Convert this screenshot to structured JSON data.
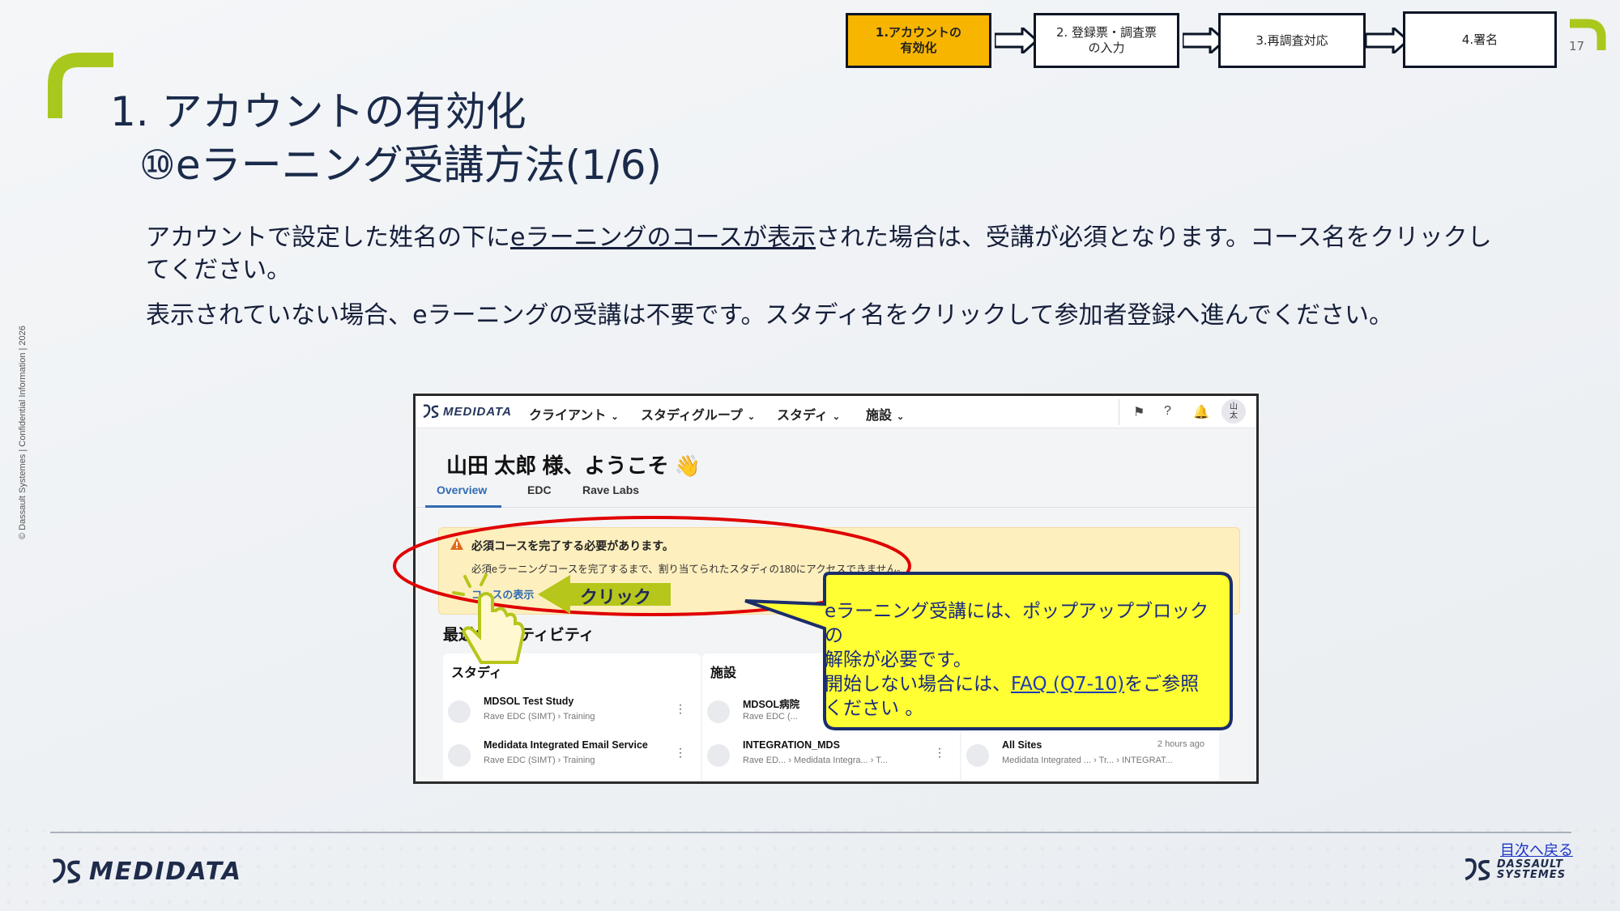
{
  "page": {
    "number": "17",
    "side_note": "© Dassault Systemes | Confidential Information | 2026"
  },
  "steps": [
    {
      "label": "1.アカウントの\n有効化",
      "active": true
    },
    {
      "label": "2. 登録票・調査票\nの入力",
      "active": false
    },
    {
      "label": "3.再調査対応",
      "active": false
    },
    {
      "label": "4.署名",
      "active": false
    }
  ],
  "title": {
    "line1": "1. アカウントの有効化",
    "line2": "⑩eラーニング受講方法(1/6)"
  },
  "body": {
    "para1_a": "アカウントで設定した姓名の下に",
    "para1_link": "eラーニングのコースが表示",
    "para1_b": "された場合は、受講が必須となります。コース名をクリックし",
    "para1_c": "てください。",
    "para2": "表示されていない場合、eラーニングの受講は不要です。スタディ名をクリックして参加者登録へ進んでください。"
  },
  "app": {
    "logo": "MEDIDATA",
    "nav": [
      "クライアント",
      "スタディグループ",
      "スタディ",
      "施設"
    ],
    "avatar": "山\n太",
    "welcome": "山田 太郎 様、ようこそ 👋",
    "tabs": [
      "Overview",
      "EDC",
      "Rave Labs"
    ],
    "alert": {
      "title": "必須コースを完了する必要があります。",
      "body": "必須eラーニングコースを完了するまで、割り当てられたスタディの180にアクセスできません。",
      "link": "コースの表示"
    },
    "recent_title": "最近のアクティビティ",
    "cards": [
      {
        "head": "スタディ",
        "items": [
          {
            "name": "MDSOL Test Study",
            "sub": "Rave EDC (SIMT)  ›  Training"
          },
          {
            "name": "Medidata Integrated Email Service",
            "sub": "Rave EDC (SIMT)  ›  Training"
          }
        ]
      },
      {
        "head": "施設",
        "items": [
          {
            "name": "MDSOL病院",
            "sub": "Rave EDC (..."
          },
          {
            "name": "INTEGRATION_MDS",
            "sub": "Rave ED...  ›  Medidata Integra...  ›  T..."
          }
        ]
      },
      {
        "head": "",
        "items": [
          {
            "name": "All Sites",
            "sub": "Medidata Integrated ...  ›  Tr...  ›  INTEGRAT...",
            "time": "2 hours ago"
          }
        ]
      }
    ]
  },
  "annotation": {
    "click_label": "クリック",
    "callout_line1": "eラーニング受講には、ポップアップブロックの",
    "callout_line2": "解除が必要です。",
    "callout_line3_a": "開始しない場合には、",
    "callout_faq": "FAQ (Q7-10)",
    "callout_line3_b": "をご参照",
    "callout_line4": "ください 。"
  },
  "footer": {
    "logo": "MEDIDATA",
    "back_link": "目次へ戻る",
    "ds_line1": "DASSAULT",
    "ds_line2": "SYSTEMES"
  },
  "colors": {
    "accent_green": "#a8c81e",
    "active_step": "#f7b500",
    "callout_yellow": "#ffff33",
    "callout_border": "#1b2d6b",
    "oval_red": "#e00000",
    "link_blue": "#1a33c8"
  }
}
